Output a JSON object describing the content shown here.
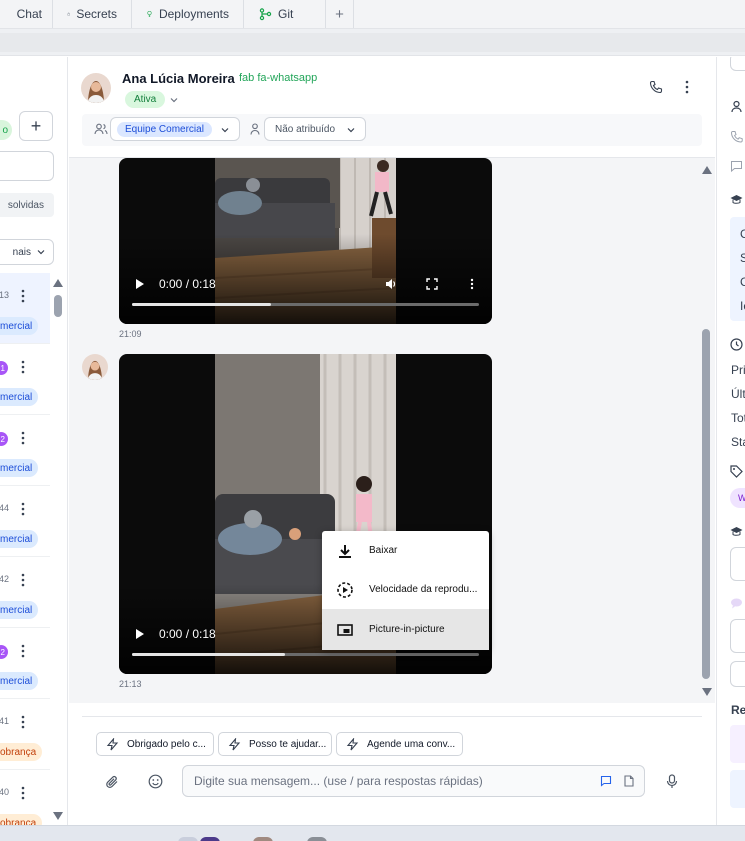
{
  "tabs": [
    {
      "label": "Chat",
      "icon": "chat-icon"
    },
    {
      "label": "Secrets",
      "icon": "lock-icon"
    },
    {
      "label": "Deployments",
      "icon": "deploy-icon"
    },
    {
      "label": "Git",
      "icon": "git-icon"
    }
  ],
  "sidebar": {
    "resolved_filter": "solvidas",
    "channel_filter": "nais",
    "conversations": [
      {
        "time": "13",
        "badge": "",
        "tag": "mercial",
        "tag_color": "blue",
        "active": true
      },
      {
        "time": "",
        "badge": "1",
        "tag": "mercial",
        "tag_color": "blue",
        "active": false
      },
      {
        "time": "",
        "badge": "2",
        "tag": "mercial",
        "tag_color": "blue",
        "active": false
      },
      {
        "time": "44",
        "badge": "",
        "tag": "mercial",
        "tag_color": "blue",
        "active": false
      },
      {
        "time": "42",
        "badge": "",
        "tag": "mercial",
        "tag_color": "blue",
        "active": false
      },
      {
        "time": "",
        "badge": "2",
        "tag": "mercial",
        "tag_color": "blue",
        "active": false
      },
      {
        "time": "41",
        "badge": "",
        "tag": "obrança",
        "tag_color": "orange",
        "active": false
      },
      {
        "time": "40",
        "badge": "",
        "tag": "obrança",
        "tag_color": "orange",
        "active": false
      }
    ]
  },
  "chat": {
    "contact_name": "Ana Lúcia Moreira",
    "channel_label": "fab fa-whatsapp",
    "status": "Ativa",
    "team": "Equipe Comercial",
    "assignee": "Não atribuído"
  },
  "messages": [
    {
      "type": "video",
      "current_time": "0:00",
      "duration": "0:18",
      "time_display": "0:00 / 0:18",
      "progress": 0.4,
      "sent_at": "21:09"
    },
    {
      "type": "video",
      "current_time": "0:00",
      "duration": "0:18",
      "time_display": "0:00 / 0:18",
      "progress": 0.44,
      "sent_at": "21:13"
    }
  ],
  "context_menu": {
    "items": [
      {
        "label": "Baixar",
        "icon": "download-icon"
      },
      {
        "label": "Velocidade da reprodu...",
        "icon": "playback-speed-icon"
      },
      {
        "label": "Picture-in-picture",
        "icon": "picture-in-picture-icon",
        "highlighted": true
      }
    ]
  },
  "composer": {
    "quick_replies": [
      "Obrigado pelo c...",
      "Posso te ajudar...",
      "Agende uma conv..."
    ],
    "placeholder": "Digite sua mensagem... (use / para respostas rápidas)"
  },
  "details": {
    "lines_a": [
      "C",
      "S",
      "C",
      "Ic"
    ],
    "lines_b": [
      "Pri",
      "Últ",
      "Tot",
      "Sta"
    ],
    "tag": "W",
    "section_label": "Res"
  },
  "colors": {
    "status_green": "#15803d",
    "whatsapp_green": "#22a559",
    "team_blue": "#1d4ed8",
    "unread_purple": "#a855f7",
    "tag_orange": "#c2410c"
  }
}
